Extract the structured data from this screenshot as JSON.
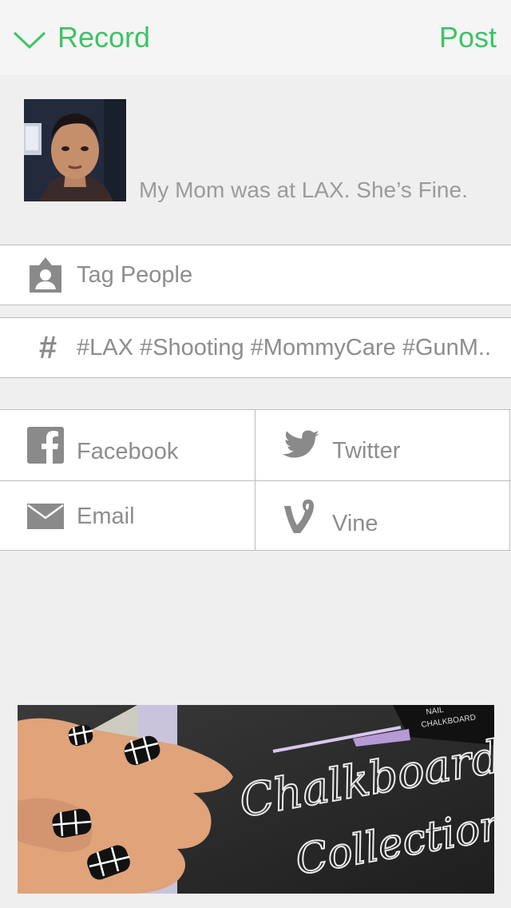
{
  "header": {
    "back_label": "Record",
    "post_label": "Post",
    "accent_color": "#3dc463"
  },
  "post": {
    "caption": "My Mom was at LAX. She’s Fine."
  },
  "tag_people": {
    "label": "Tag People",
    "icon": "person-tag-icon"
  },
  "hashtags": {
    "symbol": "#",
    "value": "#LAX #Shooting #MommyCare #GunM.."
  },
  "share": {
    "facebook": "Facebook",
    "twitter": "Twitter",
    "email": "Email",
    "vine": "Vine"
  },
  "ad": {
    "line1": "Chalkboard",
    "line2": "Collection",
    "bottle_text_1": "NAIL",
    "bottle_text_2": "CHALKBOARD"
  }
}
